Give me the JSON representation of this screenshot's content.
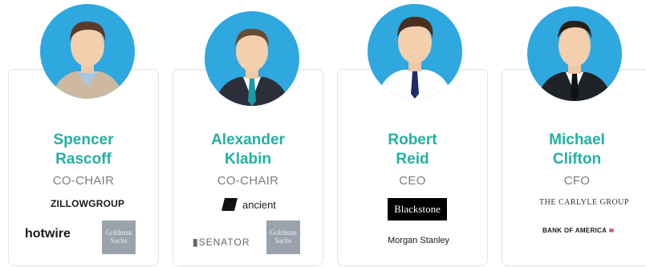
{
  "people": [
    {
      "first": "Spencer",
      "last": "Rascoff",
      "role": "CO-CHAIR",
      "logos": [
        "ZILLOWGROUP",
        "hotwire",
        "Goldman Sachs"
      ]
    },
    {
      "first": "Alexander",
      "last": "Klabin",
      "role": "CO-CHAIR",
      "logos": [
        "ancient",
        "SENATOR",
        "Goldman Sachs"
      ]
    },
    {
      "first": "Robert",
      "last": "Reid",
      "role": "CEO",
      "logos": [
        "Blackstone",
        "Morgan Stanley"
      ]
    },
    {
      "first": "Michael",
      "last": "Clifton",
      "role": "CFO",
      "logos": [
        "THE CARLYLE GROUP",
        "BANK OF AMERICA"
      ]
    }
  ],
  "colors": {
    "accent": "#23b0a3",
    "avatar_bg": "#2fa7df",
    "role": "#7d7d7d"
  }
}
